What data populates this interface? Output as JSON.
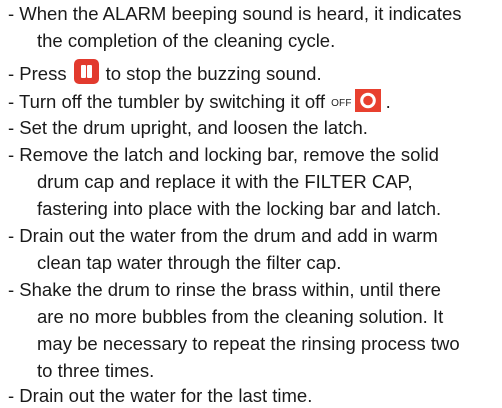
{
  "lines": [
    "- When the ALARM beeping sound is heard, it indicates",
    "the completion of the cleaning cycle.",
    "- Press",
    "to stop the buzzing sound.",
    "- Turn off the tumbler by switching it off",
    "OFF",
    ".",
    "- Set the drum upright, and loosen the latch.",
    "- Remove the latch and locking bar, remove the solid",
    "drum cap and replace it with the FILTER CAP,",
    "fastering into place with the locking bar and latch.",
    "- Drain out the water from the drum and add in warm",
    "clean tap water through the filter cap.",
    "- Shake the drum to rinse the brass within, until there",
    "are no more bubbles from the cleaning solution. It",
    "may be necessary to repeat the rinsing process two",
    "to three times.",
    "- Drain out the water for the last time."
  ],
  "icons": {
    "pause": "pause-icon",
    "power": "power-icon"
  },
  "colors": {
    "icon_red": "#e23a2e",
    "text": "#1a1a1a"
  }
}
